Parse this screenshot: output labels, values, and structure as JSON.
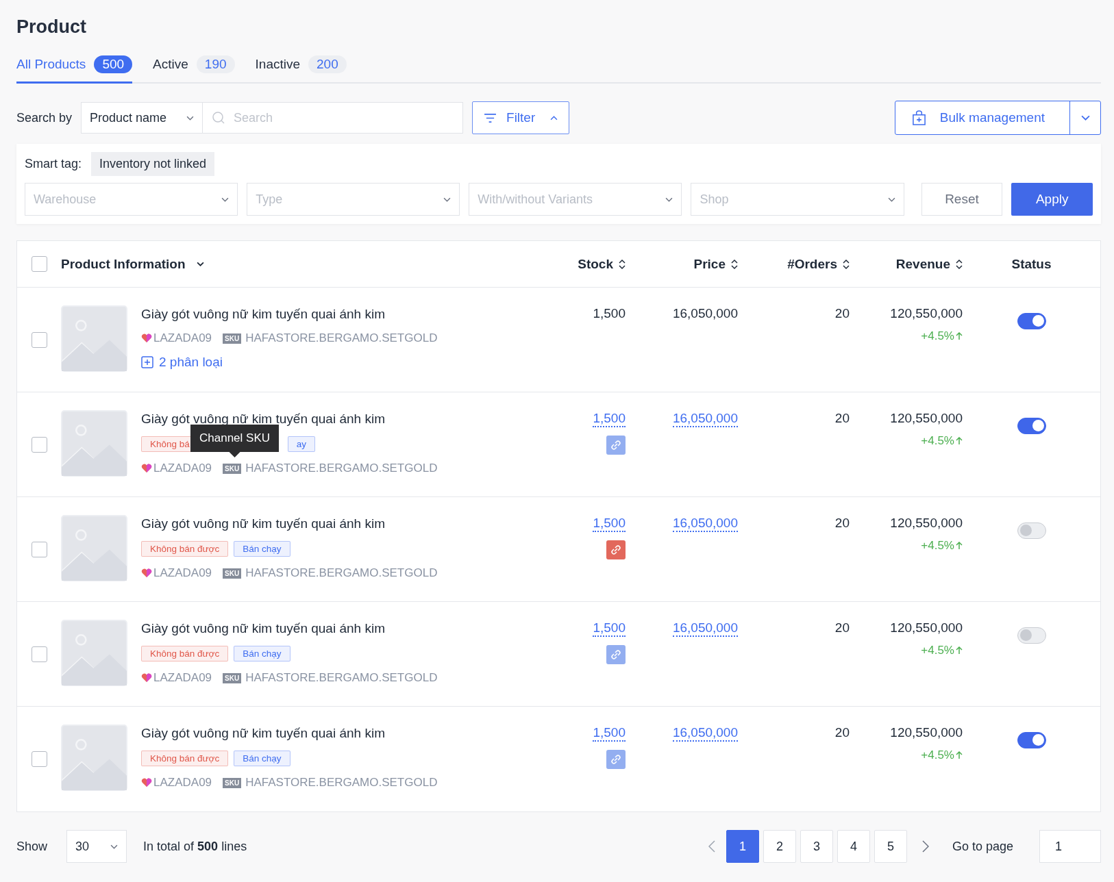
{
  "title": "Product",
  "tabs": [
    {
      "label": "All Products",
      "count": "500",
      "selected": true
    },
    {
      "label": "Active",
      "count": "190",
      "selected": false
    },
    {
      "label": "Inactive",
      "count": "200",
      "selected": false
    }
  ],
  "search": {
    "label": "Search by",
    "field": "Product name",
    "placeholder": "Search",
    "filter": "Filter",
    "filter_expanded": true,
    "bulk": "Bulk management"
  },
  "filters": {
    "smart_tag_label": "Smart tag:",
    "smart_tag": "Inventory not linked",
    "selects": [
      "Warehouse",
      "Type",
      "With/without Variants",
      "Shop"
    ],
    "reset": "Reset",
    "apply": "Apply"
  },
  "table": {
    "all_checked": false,
    "columns": [
      {
        "label": "Product Information",
        "sort": false
      },
      {
        "label": "Stock",
        "sort": true
      },
      {
        "label": "Price",
        "sort": true
      },
      {
        "label": "#Orders",
        "sort": true
      },
      {
        "label": "Revenue",
        "sort": true
      },
      {
        "label": "Status",
        "sort": false
      }
    ],
    "rows": [
      {
        "kind": "variants",
        "checked": false,
        "name": "Giày gót vuông nữ kim tuyến quai ánh kim",
        "tags": [],
        "shop": "LAZADA09",
        "sku_label": "SKU",
        "sku": "HAFASTORE.BERGAMO.SETGOLD",
        "variants": "2 phân loại",
        "stock": "1,500",
        "price": "16,050,000",
        "orders": "20",
        "revenue": "120,550,000",
        "change": "+4.5%",
        "on": true
      },
      {
        "kind": "single",
        "checked": false,
        "name": "Giày gót vuông nữ kim tuyến quai ánh kim",
        "tags": [
          {
            "text": "Không bá",
            "color": "#e0574a"
          },
          {
            "text": "ay",
            "color": "#3f6df0"
          }
        ],
        "tooltip": "Channel SKU",
        "shop": "LAZADA09",
        "sku_label": "SKU",
        "sku": "HAFASTORE.BERGAMO.SETGOLD",
        "stock": "1,500",
        "link_error": false,
        "price": "16,050,000",
        "orders": "20",
        "revenue": "120,550,000",
        "change": "+4.5%",
        "on": true
      },
      {
        "kind": "single",
        "checked": false,
        "name": "Giày gót vuông nữ kim tuyến quai ánh kim",
        "tags": [
          {
            "text": "Không bán được",
            "color": "#e0574a"
          },
          {
            "text": "Bán chạy",
            "color": "#3f6df0"
          }
        ],
        "shop": "LAZADA09",
        "sku_label": "SKU",
        "sku": "HAFASTORE.BERGAMO.SETGOLD",
        "stock": "1,500",
        "link_error": true,
        "price": "16,050,000",
        "orders": "20",
        "revenue": "120,550,000",
        "change": "+4.5%",
        "on": false
      },
      {
        "kind": "single",
        "checked": false,
        "name": "Giày gót vuông nữ kim tuyến quai ánh kim",
        "tags": [
          {
            "text": "Không bán được",
            "color": "#e0574a"
          },
          {
            "text": "Bán chạy",
            "color": "#3f6df0"
          }
        ],
        "shop": "LAZADA09",
        "sku_label": "SKU",
        "sku": "HAFASTORE.BERGAMO.SETGOLD",
        "stock": "1,500",
        "link_error": false,
        "price": "16,050,000",
        "orders": "20",
        "revenue": "120,550,000",
        "change": "+4.5%",
        "on": false
      },
      {
        "kind": "single",
        "checked": false,
        "name": "Giày gót vuông nữ kim tuyến quai ánh kim",
        "tags": [
          {
            "text": "Không bán được",
            "color": "#e0574a"
          },
          {
            "text": "Bán chạy",
            "color": "#3f6df0"
          }
        ],
        "shop": "LAZADA09",
        "sku_label": "SKU",
        "sku": "HAFASTORE.BERGAMO.SETGOLD",
        "stock": "1,500",
        "link_error": false,
        "price": "16,050,000",
        "orders": "20",
        "revenue": "120,550,000",
        "change": "+4.5%",
        "on": true
      }
    ]
  },
  "footer": {
    "show_label": "Show",
    "page_size": "30",
    "total": "In total of **500** lines",
    "pages": [
      {
        "label": "1",
        "selected": true
      },
      {
        "label": "2",
        "selected": false
      },
      {
        "label": "3",
        "selected": false
      },
      {
        "label": "4",
        "selected": false
      },
      {
        "label": "5",
        "selected": false
      }
    ],
    "goto_label": "Go to page",
    "goto_value": "1"
  }
}
